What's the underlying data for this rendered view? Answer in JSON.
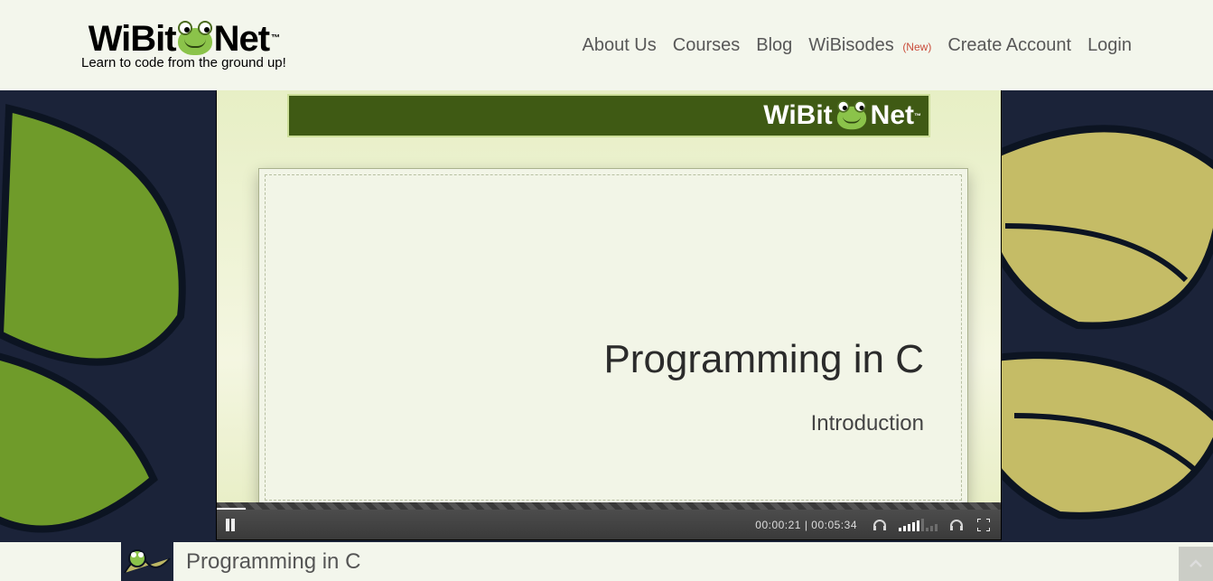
{
  "logo": {
    "pre": "WiBit",
    "post": "Net",
    "tm": "™",
    "tagline": "Learn to code from the ground up!"
  },
  "nav": {
    "about": "About Us",
    "courses": "Courses",
    "blog": "Blog",
    "wibisodes": "WiBisodes",
    "wibisodes_badge": "(New)",
    "create": "Create Account",
    "login": "Login"
  },
  "video": {
    "slide_title": "Programming in C",
    "slide_subtitle": "Introduction",
    "banner_pre": "WiBit",
    "banner_post": "Net",
    "banner_tm": "™",
    "time_current": "00:00:21",
    "time_sep": " | ",
    "time_total": "00:05:34"
  },
  "breadcrumb": {
    "title": "Programming in C"
  }
}
